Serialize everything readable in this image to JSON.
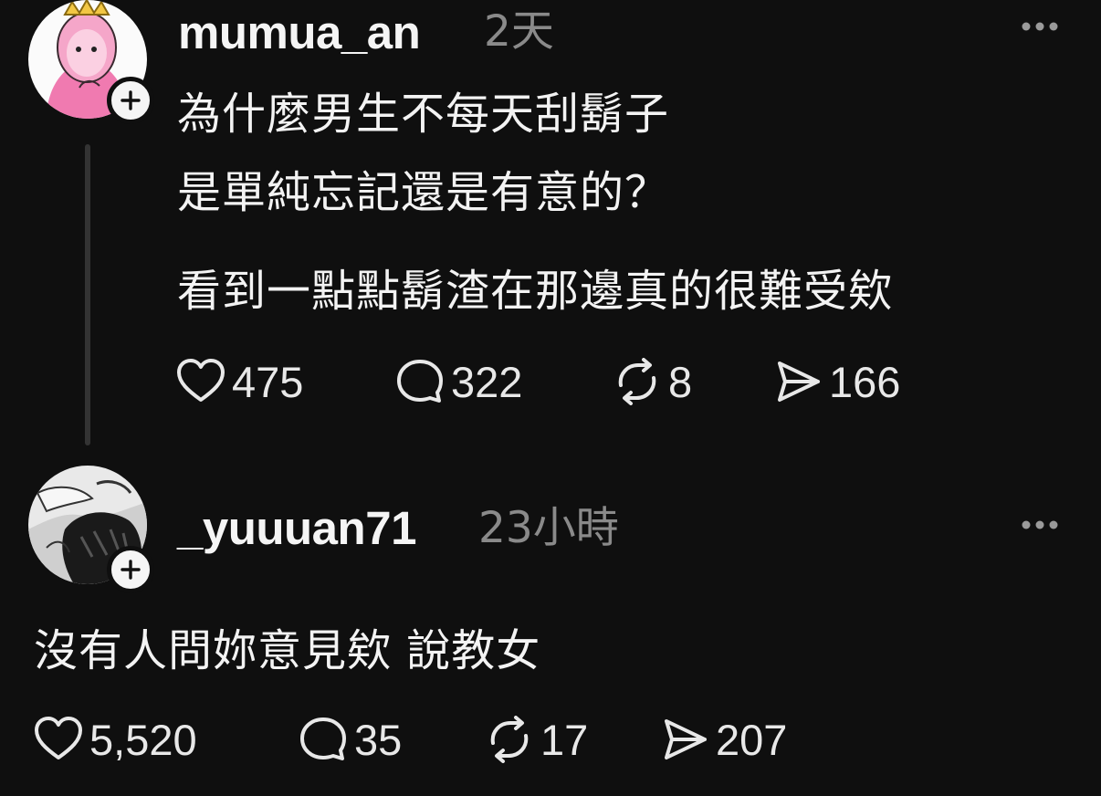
{
  "posts": [
    {
      "username": "mumua_an",
      "time": "2天",
      "lines": [
        "為什麼男生不每天刮鬍子",
        "是單純忘記還是有意的？",
        "看到一點點鬍渣在那邊真的很難受欸"
      ],
      "likes": "475",
      "comments": "322",
      "reposts": "8",
      "shares": "166"
    },
    {
      "username": "_yuuuan71",
      "time": "23小時",
      "lines": [
        "沒有人問妳意見欸 說教女"
      ],
      "likes": "5,520",
      "comments": "35",
      "reposts": "17",
      "shares": "207"
    }
  ],
  "icons": {
    "follow": "plus-icon",
    "more": "more-horizontal-icon",
    "like": "heart-icon",
    "comment": "comment-bubble-icon",
    "repost": "repost-icon",
    "share": "send-icon"
  },
  "colors": {
    "background": "#0f0f0f",
    "text": "#f3f3f3",
    "muted": "#8a8a8a"
  }
}
